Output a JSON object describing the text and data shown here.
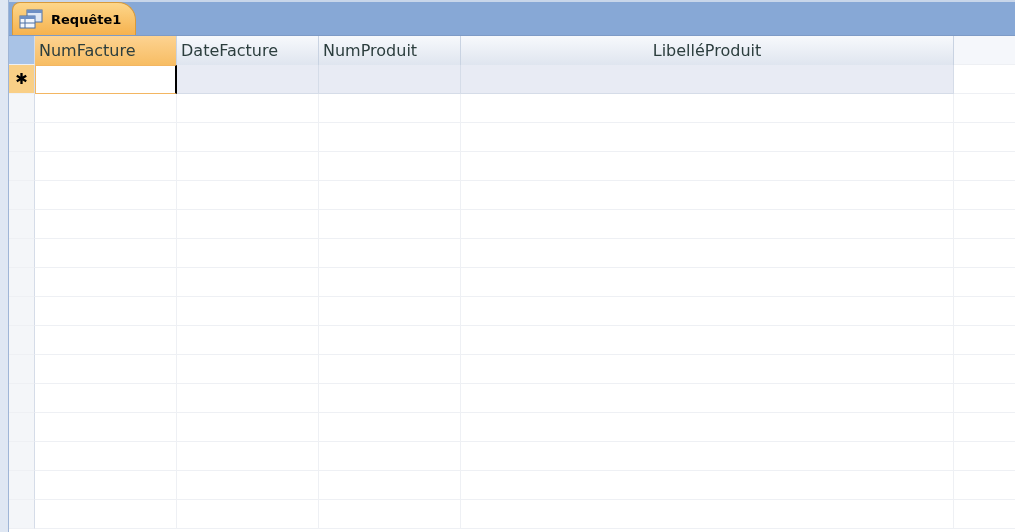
{
  "tab": {
    "title": "Requête1",
    "selected": true
  },
  "columns": [
    {
      "label": "NumFacture",
      "selected": true
    },
    {
      "label": "DateFacture",
      "selected": false
    },
    {
      "label": "NumProduit",
      "selected": false
    },
    {
      "label": "LibelléProduit",
      "selected": false
    }
  ],
  "new_row": {
    "marker": "✱",
    "selected": true
  }
}
